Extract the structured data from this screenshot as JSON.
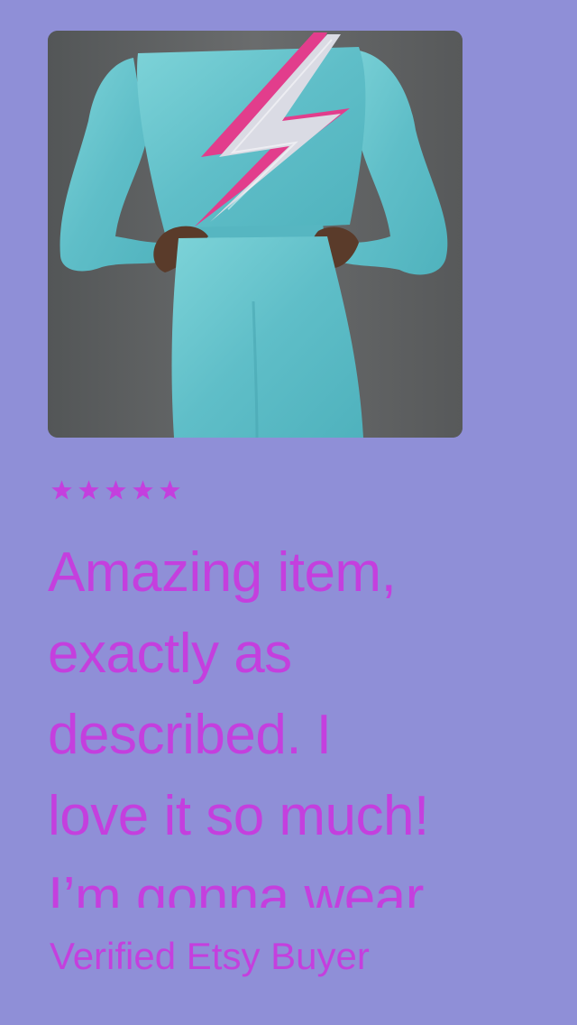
{
  "review": {
    "photo_name": "product-photo",
    "rating": 5,
    "rating_max": 5,
    "stars": [
      "★",
      "★",
      "★",
      "★",
      "★"
    ],
    "text": "Amazing item,\nexactly as\ndescribed. I\nlove it so much!\nI’m gonna wear",
    "reviewer": "Verified Etsy Buyer"
  },
  "colors": {
    "background": "#8f8fd7",
    "accent": "#c43fde",
    "photo_backdrop": "#5f6162",
    "jumpsuit": "#6cc7cf",
    "bolt_silver": "#d9d9e2",
    "bolt_pink": "#e23d8c"
  }
}
